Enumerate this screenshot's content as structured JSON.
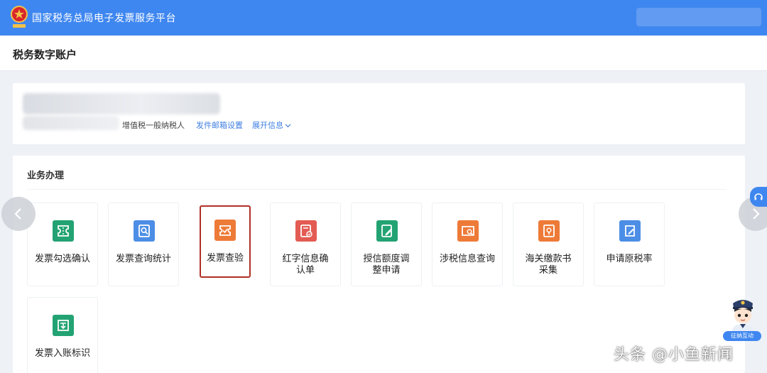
{
  "header": {
    "platform_title": "国家税务总局电子发票服务平台",
    "emblem_icon": "national-tax-emblem-icon",
    "brand_color": "#3f87f0"
  },
  "page": {
    "title": "税务数字账户"
  },
  "account": {
    "taxpayer_type": "增值税一般纳税人",
    "email_settings_link": "发件邮箱设置",
    "expand_info_link": "展开信息",
    "link_color": "#3f7fe0"
  },
  "business": {
    "section_title": "业务办理",
    "tiles": [
      {
        "label": "发票勾选确认",
        "icon": "invoice-check-icon",
        "color": "#23a373"
      },
      {
        "label": "发票查询统计",
        "icon": "invoice-search-icon",
        "color": "#4c8ee6"
      },
      {
        "label": "发票查验",
        "icon": "invoice-verify-icon",
        "color": "#ee7a38",
        "highlighted": true
      },
      {
        "label": "红字信息确认单",
        "icon": "red-letter-info-icon",
        "color": "#e35b52"
      },
      {
        "label": "授信额度调整申请",
        "icon": "credit-limit-icon",
        "color": "#23a373"
      },
      {
        "label": "涉税信息查询",
        "icon": "tax-info-search-icon",
        "color": "#ee7a38"
      },
      {
        "label": "海关缴款书采集",
        "icon": "customs-payment-icon",
        "color": "#ee7a38"
      },
      {
        "label": "申请原税率",
        "icon": "original-tax-rate-icon",
        "color": "#4c8ee6"
      },
      {
        "label": "发票入账标识",
        "icon": "invoice-booking-icon",
        "color": "#23a373"
      }
    ],
    "highlight_color": "#b03026"
  },
  "floating": {
    "support_icon": "headset-icon",
    "assistant_icon": "tax-officer-assistant-icon",
    "assistant_label": "征纳互动"
  },
  "watermark": {
    "text": "头条 @小鱼新闻"
  }
}
